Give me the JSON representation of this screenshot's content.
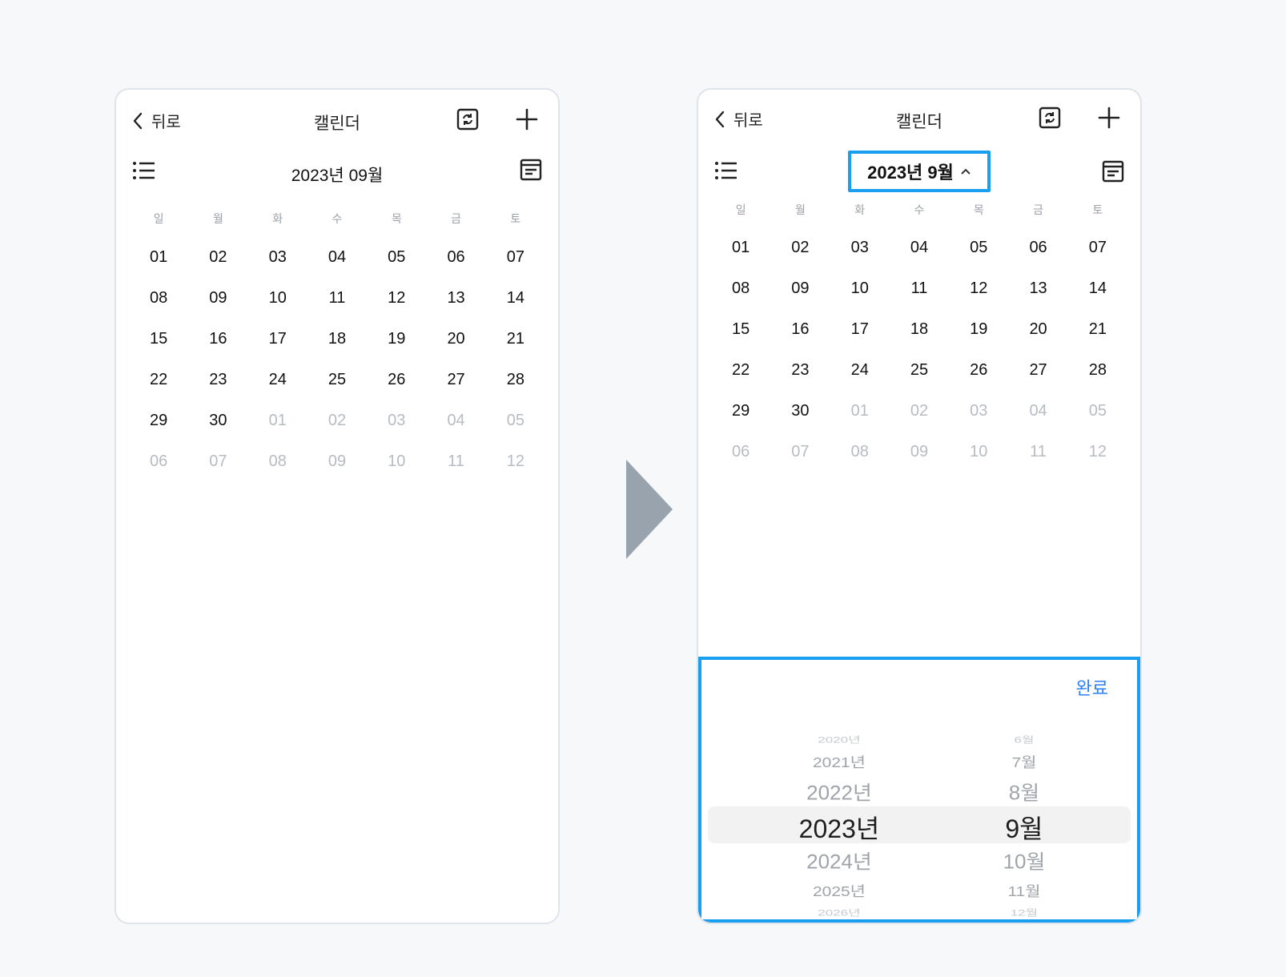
{
  "header": {
    "back_label": "뒤로",
    "title": "캘린더"
  },
  "left": {
    "month_label": "2023년 09월"
  },
  "right": {
    "month_label": "2023년 9월"
  },
  "weekdays": [
    "일",
    "월",
    "화",
    "수",
    "목",
    "금",
    "토"
  ],
  "days": [
    {
      "d": "01",
      "m": false
    },
    {
      "d": "02",
      "m": false
    },
    {
      "d": "03",
      "m": false
    },
    {
      "d": "04",
      "m": false
    },
    {
      "d": "05",
      "m": false
    },
    {
      "d": "06",
      "m": false
    },
    {
      "d": "07",
      "m": false
    },
    {
      "d": "08",
      "m": false
    },
    {
      "d": "09",
      "m": false
    },
    {
      "d": "10",
      "m": false
    },
    {
      "d": "11",
      "m": false
    },
    {
      "d": "12",
      "m": false
    },
    {
      "d": "13",
      "m": false
    },
    {
      "d": "14",
      "m": false
    },
    {
      "d": "15",
      "m": false
    },
    {
      "d": "16",
      "m": false
    },
    {
      "d": "17",
      "m": false
    },
    {
      "d": "18",
      "m": false
    },
    {
      "d": "19",
      "m": false
    },
    {
      "d": "20",
      "m": false
    },
    {
      "d": "21",
      "m": false
    },
    {
      "d": "22",
      "m": false
    },
    {
      "d": "23",
      "m": false
    },
    {
      "d": "24",
      "m": false
    },
    {
      "d": "25",
      "m": false
    },
    {
      "d": "26",
      "m": false
    },
    {
      "d": "27",
      "m": false
    },
    {
      "d": "28",
      "m": false
    },
    {
      "d": "29",
      "m": false
    },
    {
      "d": "30",
      "m": false
    },
    {
      "d": "01",
      "m": true
    },
    {
      "d": "02",
      "m": true
    },
    {
      "d": "03",
      "m": true
    },
    {
      "d": "04",
      "m": true
    },
    {
      "d": "05",
      "m": true
    },
    {
      "d": "06",
      "m": true
    },
    {
      "d": "07",
      "m": true
    },
    {
      "d": "08",
      "m": true
    },
    {
      "d": "09",
      "m": true
    },
    {
      "d": "10",
      "m": true
    },
    {
      "d": "11",
      "m": true
    },
    {
      "d": "12",
      "m": true
    }
  ],
  "picker": {
    "done_label": "완료",
    "years": [
      "2020년",
      "2021년",
      "2022년",
      "2023년",
      "2024년",
      "2025년",
      "2026년"
    ],
    "months": [
      "6월",
      "7월",
      "8월",
      "9월",
      "10월",
      "11월",
      "12월"
    ],
    "selected_year": "2023년",
    "selected_month": "9월"
  },
  "colors": {
    "accent": "#1a9ef0",
    "done": "#2f7ff5",
    "muted": "#b7bcc3",
    "arrow": "#98a3ae"
  },
  "icons": [
    "chevron-left-icon",
    "sync-icon",
    "plus-icon",
    "list-icon",
    "calendar-view-icon",
    "chevron-up-icon"
  ]
}
